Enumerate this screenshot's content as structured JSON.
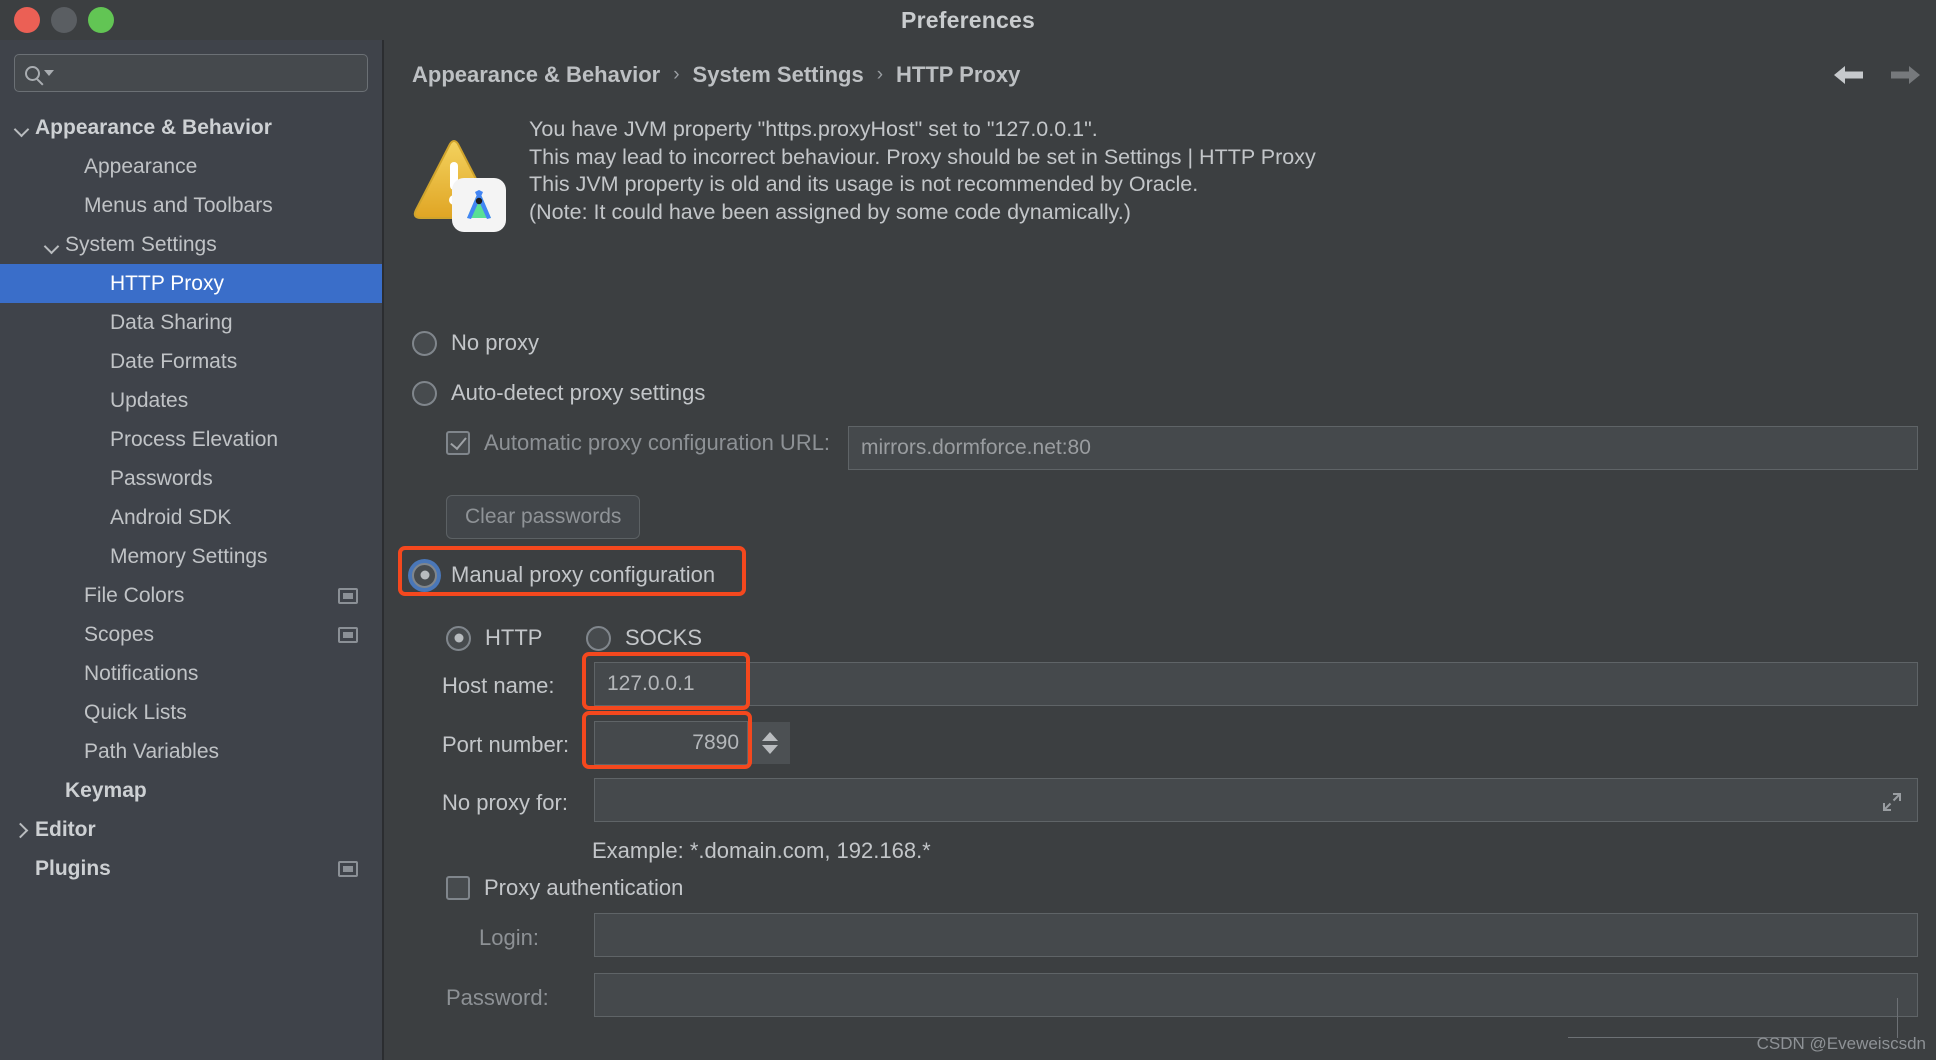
{
  "window": {
    "title": "Preferences",
    "traffic_lights": [
      "close-red",
      "minimize-yellow",
      "zoom-green"
    ]
  },
  "sidebar": {
    "search": {
      "placeholder": "",
      "value": "",
      "icon": "search-icon"
    },
    "items": [
      {
        "label": "Appearance & Behavior",
        "level": 0,
        "expander": "down",
        "bold": true,
        "selected": false,
        "badge": false
      },
      {
        "label": "Appearance",
        "level": 1,
        "expander": "none",
        "bold": false,
        "selected": false,
        "badge": false
      },
      {
        "label": "Menus and Toolbars",
        "level": 1,
        "expander": "none",
        "bold": false,
        "selected": false,
        "badge": false
      },
      {
        "label": "System Settings",
        "level": 2,
        "expander": "down",
        "bold": false,
        "selected": false,
        "badge": false
      },
      {
        "label": "HTTP Proxy",
        "level": 3,
        "expander": "none",
        "bold": false,
        "selected": true,
        "badge": false
      },
      {
        "label": "Data Sharing",
        "level": 3,
        "expander": "none",
        "bold": false,
        "selected": false,
        "badge": false
      },
      {
        "label": "Date Formats",
        "level": 3,
        "expander": "none",
        "bold": false,
        "selected": false,
        "badge": false
      },
      {
        "label": "Updates",
        "level": 3,
        "expander": "none",
        "bold": false,
        "selected": false,
        "badge": false
      },
      {
        "label": "Process Elevation",
        "level": 3,
        "expander": "none",
        "bold": false,
        "selected": false,
        "badge": false
      },
      {
        "label": "Passwords",
        "level": 3,
        "expander": "none",
        "bold": false,
        "selected": false,
        "badge": false
      },
      {
        "label": "Android SDK",
        "level": 3,
        "expander": "none",
        "bold": false,
        "selected": false,
        "badge": false
      },
      {
        "label": "Memory Settings",
        "level": 3,
        "expander": "none",
        "bold": false,
        "selected": false,
        "badge": false
      },
      {
        "label": "File Colors",
        "level": 1,
        "expander": "none",
        "bold": false,
        "selected": false,
        "badge": true
      },
      {
        "label": "Scopes",
        "level": 1,
        "expander": "none",
        "bold": false,
        "selected": false,
        "badge": true
      },
      {
        "label": "Notifications",
        "level": 1,
        "expander": "none",
        "bold": false,
        "selected": false,
        "badge": false
      },
      {
        "label": "Quick Lists",
        "level": 1,
        "expander": "none",
        "bold": false,
        "selected": false,
        "badge": false
      },
      {
        "label": "Path Variables",
        "level": 1,
        "expander": "none",
        "bold": false,
        "selected": false,
        "badge": false
      },
      {
        "label": "Keymap",
        "level": 2,
        "expander": "none",
        "bold": true,
        "selected": false,
        "badge": false
      },
      {
        "label": "Editor",
        "level": 0,
        "expander": "right",
        "bold": true,
        "selected": false,
        "badge": false
      },
      {
        "label": "Plugins",
        "level": 0,
        "expander": "none",
        "bold": true,
        "selected": false,
        "badge": true
      }
    ]
  },
  "breadcrumb": {
    "items": [
      "Appearance & Behavior",
      "System Settings",
      "HTTP Proxy"
    ],
    "separator": "›",
    "back_label": "back-arrow",
    "forward_label": "forward-arrow"
  },
  "warning": {
    "icon": "warning-triangle-icon",
    "badge_icon": "android-studio-icon",
    "lines": [
      "You have JVM property \"https.proxyHost\" set to \"127.0.0.1\".",
      "This may lead to incorrect behaviour. Proxy should be set in Settings | HTTP Proxy",
      "This JVM property is old and its usage is not recommended by Oracle.",
      "(Note: It could have been assigned by some code dynamically.)"
    ]
  },
  "form": {
    "no_proxy": {
      "label": "No proxy",
      "checked": false
    },
    "auto_detect": {
      "label": "Auto-detect proxy settings",
      "checked": false
    },
    "auto_config_url": {
      "label": "Automatic proxy configuration URL:",
      "checked": true,
      "value": "mirrors.dormforce.net:80"
    },
    "clear_passwords": {
      "label": "Clear passwords"
    },
    "manual": {
      "label": "Manual proxy configuration",
      "checked": true,
      "highlighted": true
    },
    "protocol": {
      "http": {
        "label": "HTTP",
        "checked": true
      },
      "socks": {
        "label": "SOCKS",
        "checked": false
      }
    },
    "host_name": {
      "label": "Host name:",
      "value": "127.0.0.1",
      "highlighted": true
    },
    "port_number": {
      "label": "Port number:",
      "value": "7890",
      "highlighted": true
    },
    "no_proxy_for": {
      "label": "No proxy for:",
      "value": "",
      "expand_icon": "expand-icon"
    },
    "example_hint": "Example: *.domain.com, 192.168.*",
    "proxy_auth": {
      "label": "Proxy authentication",
      "checked": false
    },
    "login": {
      "label": "Login:",
      "value": ""
    },
    "password": {
      "label": "Password:",
      "value": ""
    }
  },
  "watermark": "CSDN @Eveweiscsdn",
  "colors": {
    "window_bg": "#3c3f41",
    "sidebar_bg": "#3f434a",
    "selection_blue": "#3a6ec9",
    "highlight_red": "#f4481e",
    "warning_yellow": "#e8b931",
    "text": "#c3c6c9"
  }
}
